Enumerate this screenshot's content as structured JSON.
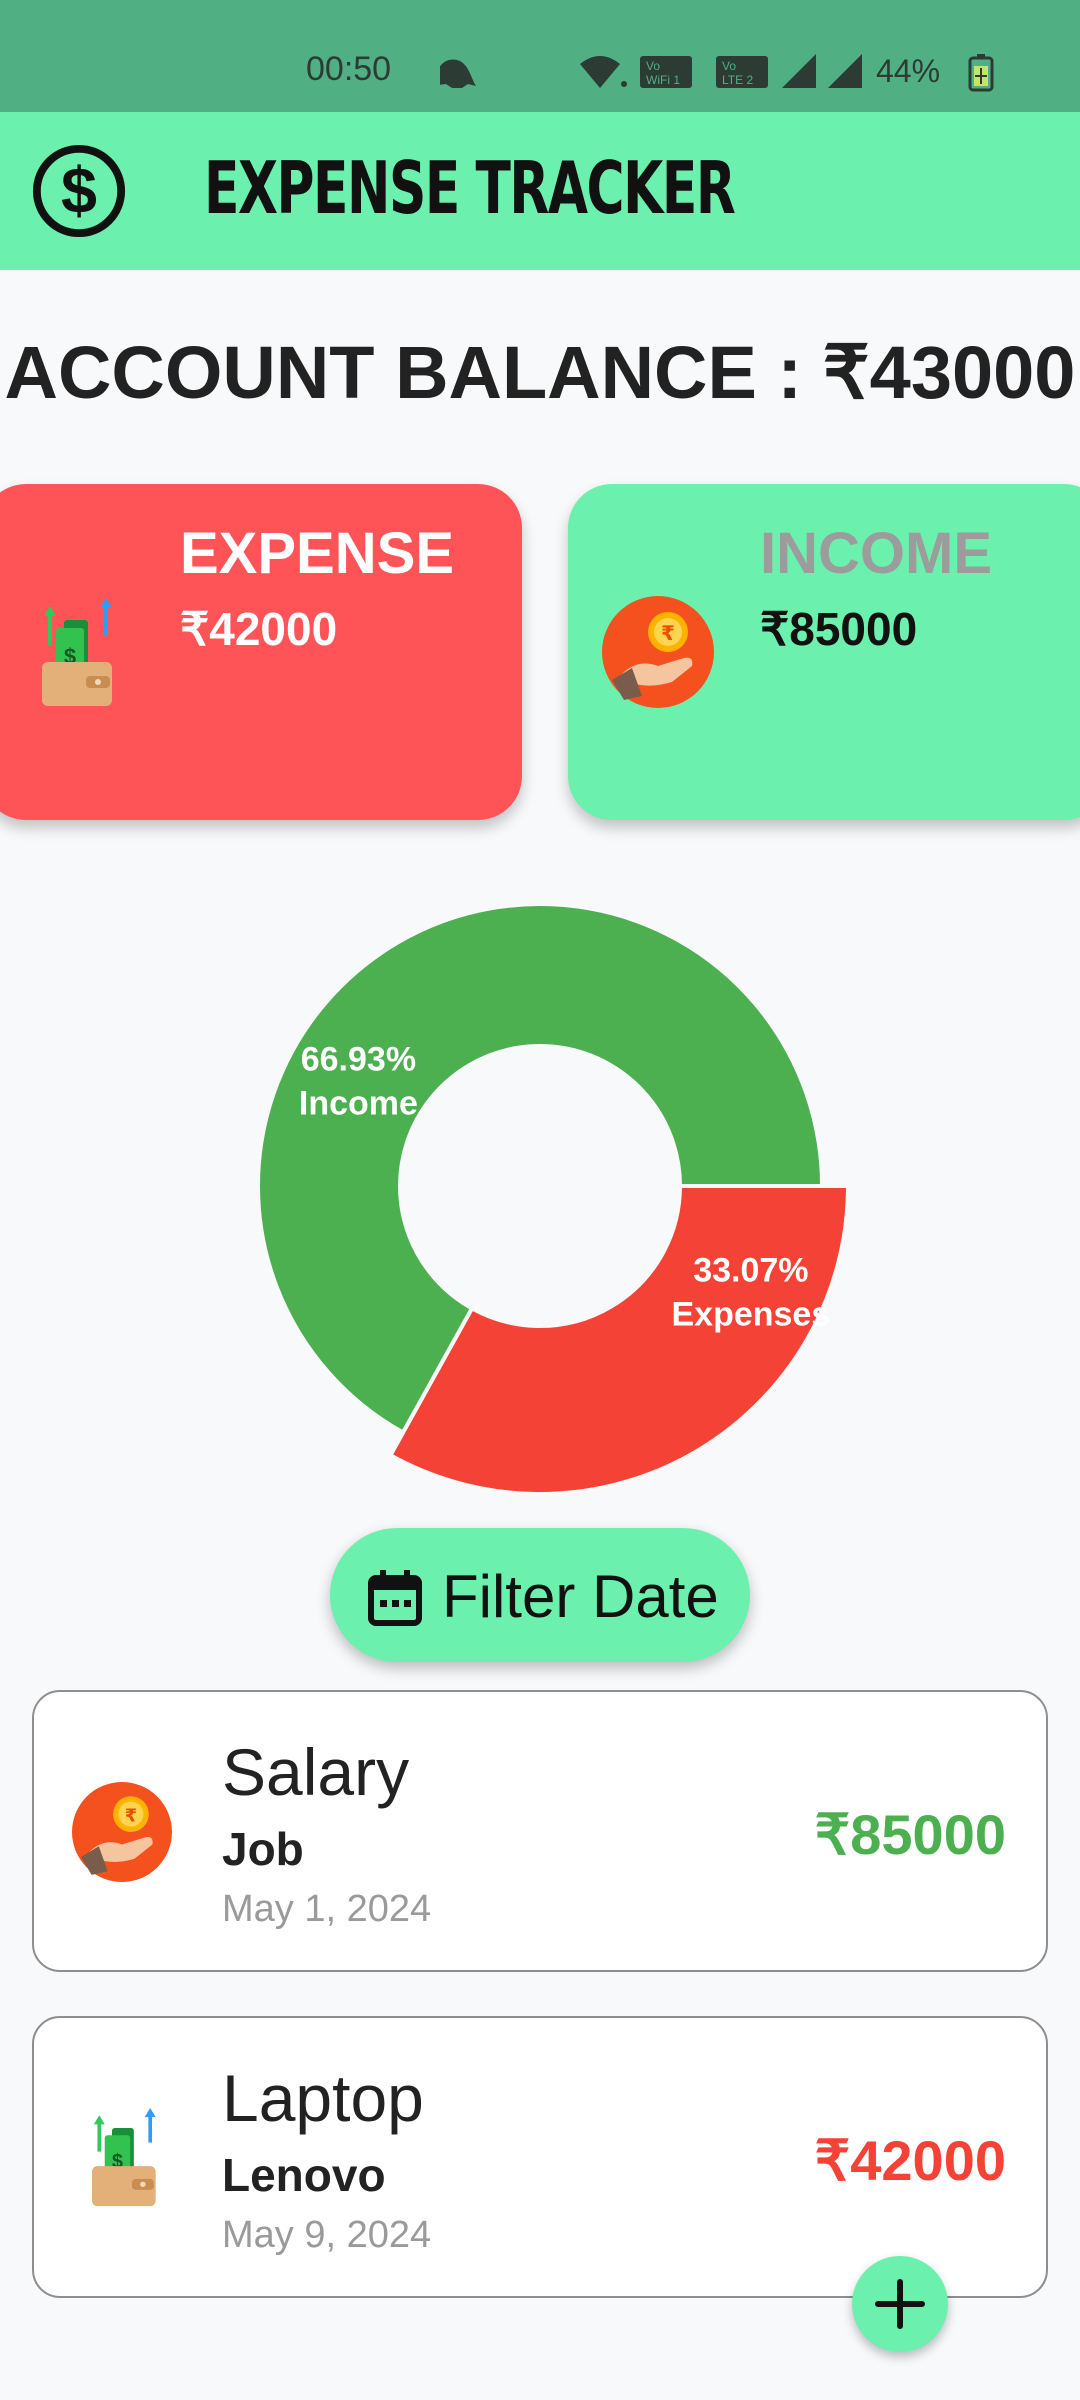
{
  "status_bar": {
    "time": "00:50",
    "battery": "44%",
    "icons": [
      "snapchat-icon",
      "wifi-icon",
      "vowifi-icon",
      "volte2-icon",
      "signal-icon",
      "signal-icon",
      "battery-icon"
    ]
  },
  "app_bar": {
    "title": "EXPENSE TRACKER",
    "icon": "dollar-icon"
  },
  "balance": {
    "label": "ACCOUNT BALANCE : ₹43000"
  },
  "cards": {
    "expense": {
      "title": "EXPENSE",
      "amount": "₹42000",
      "icon": "wallet-money-icon",
      "color": "#ff5457"
    },
    "income": {
      "title": "INCOME",
      "amount": "₹85000",
      "icon": "hand-coin-icon",
      "color": "#6cf0ad"
    }
  },
  "chart_data": {
    "type": "pie",
    "categories": [
      "Income",
      "Expenses"
    ],
    "values": [
      66.93,
      33.07
    ],
    "labels": [
      "66.93%",
      "33.07%"
    ],
    "colors": [
      "#4caf50",
      "#f44336"
    ]
  },
  "filter": {
    "label": "Filter Date",
    "icon": "calendar-icon"
  },
  "transactions": [
    {
      "title": "Salary",
      "category": "Job",
      "date": "May 1, 2024",
      "amount": "₹85000",
      "amount_color": "#4caf50",
      "icon": "hand-coin-icon"
    },
    {
      "title": "Laptop",
      "category": "Lenovo",
      "date": "May 9, 2024",
      "amount": "₹42000",
      "amount_color": "#f44336",
      "icon": "wallet-money-icon"
    }
  ],
  "fab": {
    "icon": "plus-icon",
    "color": "#6cf0ad"
  }
}
